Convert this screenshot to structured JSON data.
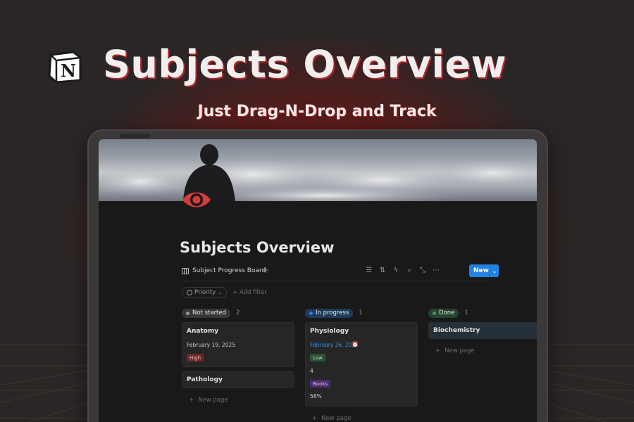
{
  "hero": {
    "logo_letter": "N",
    "title": "Subjects Overview",
    "subtitle": "Just Drag-N-Drop and Track"
  },
  "page": {
    "title": "Subjects Overview",
    "icon": "eye-icon"
  },
  "toolbar": {
    "view_label": "Subject Progress Board",
    "add_view": "+",
    "new_label": "New",
    "tools": [
      "filter-icon",
      "sort-icon",
      "lightning-icon",
      "search-icon",
      "expand-icon",
      "more-icon"
    ]
  },
  "filters": {
    "priority_label": "Priority",
    "add_filter": "+ Add filter"
  },
  "columns": [
    {
      "status": "Not started",
      "count": "2",
      "color": "#9b9b9b",
      "pill_bg": "#373737",
      "cards": [
        {
          "title": "Anatomy",
          "date": "February 19, 2025",
          "priority": "High"
        },
        {
          "title": "Pathology"
        }
      ],
      "new_page": "New page"
    },
    {
      "status": "In progress",
      "count": "1",
      "color": "#2f7fd6",
      "pill_bg": "#1f3b5c",
      "cards": [
        {
          "title": "Physiology",
          "date": "February 26, 2025",
          "priority": "Low",
          "number": "4",
          "tag": "Books",
          "percent": "58%"
        }
      ],
      "new_page": "New page"
    },
    {
      "status": "Done",
      "count": "1",
      "color": "#3d9a5d",
      "pill_bg": "#24442f",
      "cards": [
        {
          "title": "Biochemistry"
        }
      ],
      "new_page": "New page"
    }
  ],
  "colors": {
    "accent": "#2383e2",
    "hero_shadow": "#b3282b",
    "high_tag_bg": "#6b2a26",
    "low_tag_bg": "#2a5236",
    "books_tag_bg": "#4a2d6b"
  }
}
